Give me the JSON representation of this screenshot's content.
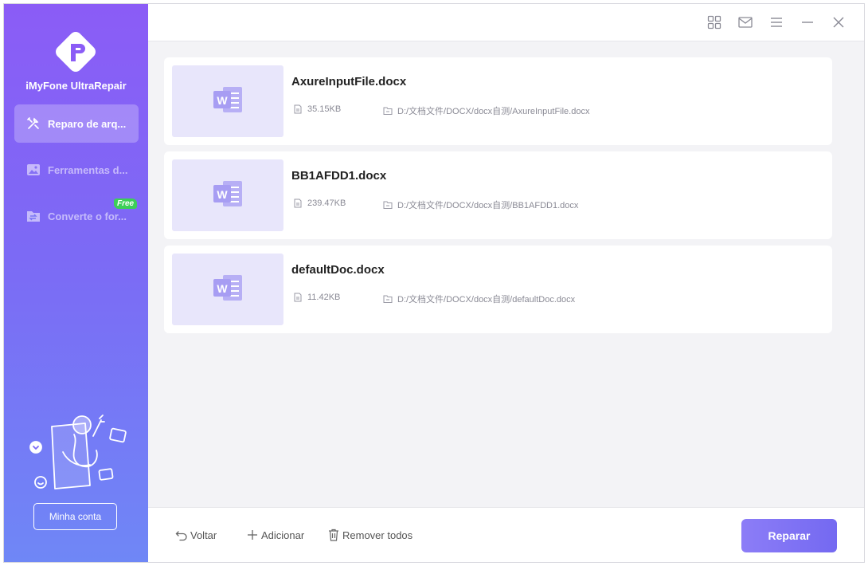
{
  "app": {
    "name": "iMyFone UltraRepair"
  },
  "sidebar": {
    "items": [
      {
        "label": "Reparo de arq...",
        "icon": "tools-icon",
        "active": true
      },
      {
        "label": "Ferramentas d...",
        "icon": "image-icon",
        "active": false
      },
      {
        "label": "Converte o for...",
        "icon": "convert-icon",
        "active": false,
        "badge": "Free"
      }
    ],
    "account_button": "Minha conta"
  },
  "titlebar": {
    "icons": [
      "grid-icon",
      "mail-icon",
      "menu-icon",
      "minimize-icon",
      "close-icon"
    ]
  },
  "files": [
    {
      "name": "AxureInputFile.docx",
      "size": "35.15KB",
      "path": "D:/文档文件/DOCX/docx自测/AxureInputFile.docx"
    },
    {
      "name": "BB1AFDD1.docx",
      "size": "239.47KB",
      "path": "D:/文档文件/DOCX/docx自测/BB1AFDD1.docx"
    },
    {
      "name": "defaultDoc.docx",
      "size": "11.42KB",
      "path": "D:/文档文件/DOCX/docx自测/defaultDoc.docx"
    }
  ],
  "footer": {
    "back": "Voltar",
    "add": "Adicionar",
    "remove_all": "Remover todos",
    "repair": "Reparar"
  },
  "colors": {
    "accent": "#7c6af5",
    "sidebar_top": "#8b5cf6",
    "sidebar_bottom": "#6f87f6",
    "badge": "#3ccf57"
  }
}
